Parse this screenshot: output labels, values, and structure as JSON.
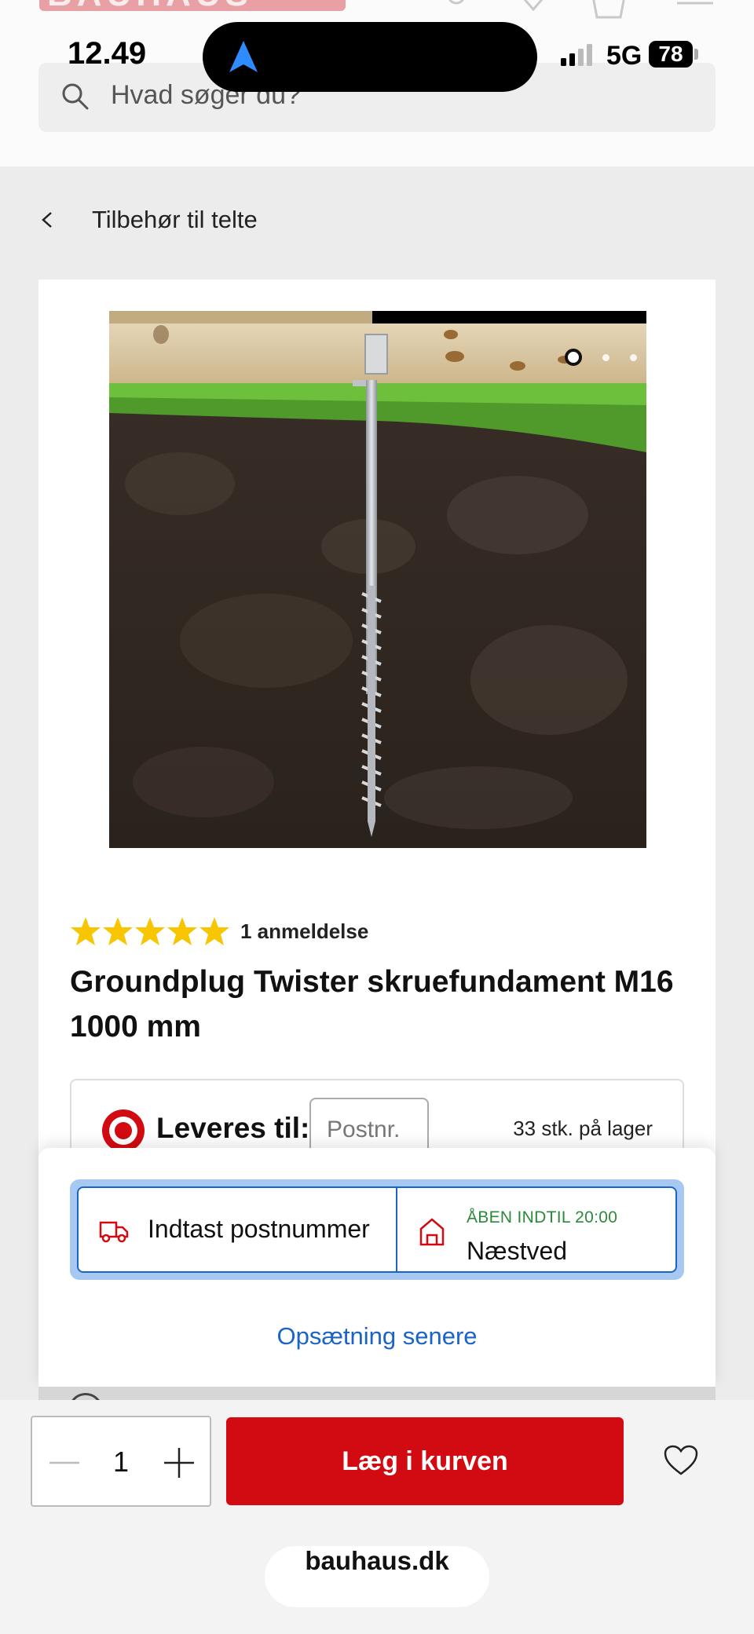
{
  "status": {
    "time": "12.49",
    "network": "5G",
    "battery": "78"
  },
  "header": {
    "logo_text": "BAUHAUS",
    "search_placeholder": "Hvad søger du?"
  },
  "breadcrumb": {
    "label": "Tilbehør til telte"
  },
  "product": {
    "image_count": 5,
    "active_image": 1,
    "rating_stars": 5,
    "review_count_label": "1 anmeldelse",
    "title": "Groundplug Twister skruefundament M16 1000 mm"
  },
  "delivery": {
    "label": "Leveres til:",
    "postnr_placeholder": "Postnr.",
    "stock": "33 stk. på lager"
  },
  "sheet": {
    "postcode_option": "Indtast postnummer",
    "store_status": "ÅBEN INDTIL 20:00",
    "store_name": "Næstved",
    "later_link": "Opsætning senere"
  },
  "cart": {
    "quantity": "1",
    "button_label": "Læg i kurven"
  },
  "browser": {
    "url": "bauhaus.dk"
  },
  "colors": {
    "brand_red": "#d20a11",
    "link_blue": "#1a64c8",
    "open_green": "#2a8a3a",
    "star": "#f7c600"
  }
}
